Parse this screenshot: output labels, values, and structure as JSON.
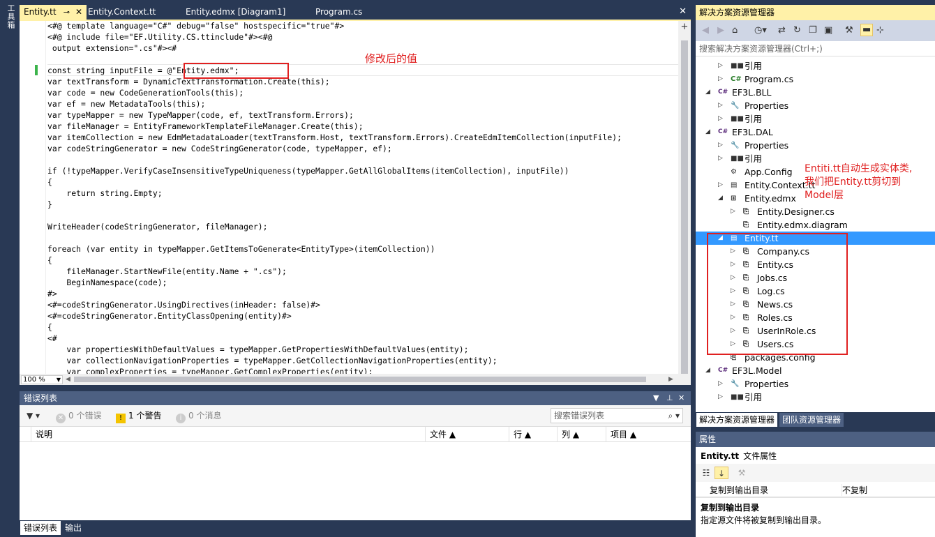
{
  "toolbox": {
    "label": "工具箱"
  },
  "editor_tabs": [
    {
      "label": "Entity.tt",
      "pin": "⊸",
      "close": "✕"
    },
    {
      "label": "Entity.Context.tt"
    },
    {
      "label": "Entity.edmx [Diagram1]"
    },
    {
      "label": "Program.cs"
    }
  ],
  "editor": {
    "lines": [
      "<#@ template language=\"C#\" debug=\"false\" hostspecific=\"true\"#>",
      "<#@ include file=\"EF.Utility.CS.ttinclude\"#><#@",
      " output extension=\".cs\"#><#",
      "",
      "const string inputFile = @\"Entity.edmx\";",
      "var textTransform = DynamicTextTransformation.Create(this);",
      "var code = new CodeGenerationTools(this);",
      "var ef = new MetadataTools(this);",
      "var typeMapper = new TypeMapper(code, ef, textTransform.Errors);",
      "var fileManager = EntityFrameworkTemplateFileManager.Create(this);",
      "var itemCollection = new EdmMetadataLoader(textTransform.Host, textTransform.Errors).CreateEdmItemCollection(inputFile);",
      "var codeStringGenerator = new CodeStringGenerator(code, typeMapper, ef);",
      "",
      "if (!typeMapper.VerifyCaseInsensitiveTypeUniqueness(typeMapper.GetAllGlobalItems(itemCollection), inputFile))",
      "{",
      "    return string.Empty;",
      "}",
      "",
      "WriteHeader(codeStringGenerator, fileManager);",
      "",
      "foreach (var entity in typeMapper.GetItemsToGenerate<EntityType>(itemCollection))",
      "{",
      "    fileManager.StartNewFile(entity.Name + \".cs\");",
      "    BeginNamespace(code);",
      "#>",
      "<#=codeStringGenerator.UsingDirectives(inHeader: false)#>",
      "<#=codeStringGenerator.EntityClassOpening(entity)#>",
      "{",
      "<#",
      "    var propertiesWithDefaultValues = typeMapper.GetPropertiesWithDefaultValues(entity);",
      "    var collectionNavigationProperties = typeMapper.GetCollectionNavigationProperties(entity);",
      "    var complexProperties = typeMapper.GetComplexProperties(entity);"
    ],
    "annotation": "修改后的值",
    "zoom": "100 %"
  },
  "error_list": {
    "title": "错误列表",
    "errors": "0 个错误",
    "warnings": "1 个警告",
    "messages": "0 个消息",
    "search_placeholder": "搜索错误列表",
    "columns": [
      "说明",
      "文件",
      "行",
      "列",
      "项目"
    ]
  },
  "bottom_tabs": [
    "错误列表",
    "输出"
  ],
  "solution_explorer": {
    "title": "解决方案资源管理器",
    "search_placeholder": "搜索解决方案资源管理器(Ctrl+;)",
    "annotation_lines": [
      "Entiti.tt自动生成实体类,",
      "我们把Entity.tt剪切到",
      "Model层"
    ],
    "tree": [
      {
        "label": "引用",
        "icon": "references-icon",
        "glyph": "■■",
        "arrow": "▷",
        "indent": 1
      },
      {
        "label": "Program.cs",
        "icon": "csharp-file-icon",
        "glyph": "C#",
        "arrow": "▷",
        "indent": 1
      },
      {
        "label": "EF3L.BLL",
        "icon": "project-icon",
        "glyph": "C#",
        "arrow": "◢",
        "indent": 0
      },
      {
        "label": "Properties",
        "icon": "wrench-icon",
        "glyph": "🔧",
        "arrow": "▷",
        "indent": 1
      },
      {
        "label": "引用",
        "icon": "references-icon",
        "glyph": "■■",
        "arrow": "▷",
        "indent": 1
      },
      {
        "label": "EF3L.DAL",
        "icon": "project-icon",
        "glyph": "C#",
        "arrow": "◢",
        "indent": 0
      },
      {
        "label": "Properties",
        "icon": "wrench-icon",
        "glyph": "🔧",
        "arrow": "▷",
        "indent": 1
      },
      {
        "label": "引用",
        "icon": "references-icon",
        "glyph": "■■",
        "arrow": "▷",
        "indent": 1
      },
      {
        "label": "App.Config",
        "icon": "config-file-icon",
        "glyph": "⚙",
        "arrow": "",
        "indent": 1
      },
      {
        "label": "Entity.Context.tt",
        "icon": "tt-file-icon",
        "glyph": "▤",
        "arrow": "▷",
        "indent": 1
      },
      {
        "label": "Entity.edmx",
        "icon": "edmx-file-icon",
        "glyph": "⊞",
        "arrow": "◢",
        "indent": 1
      },
      {
        "label": "Entity.Designer.cs",
        "icon": "cs-file-icon",
        "glyph": "⎘",
        "arrow": "▷",
        "indent": 2
      },
      {
        "label": "Entity.edmx.diagram",
        "icon": "diagram-file-icon",
        "glyph": "⎘",
        "arrow": "",
        "indent": 2
      },
      {
        "label": "Entity.tt",
        "icon": "tt-file-icon",
        "glyph": "▤",
        "arrow": "◢",
        "indent": 1,
        "selected": true
      },
      {
        "label": "Company.cs",
        "icon": "cs-file-icon",
        "glyph": "⎘",
        "arrow": "▷",
        "indent": 2
      },
      {
        "label": "Entity.cs",
        "icon": "cs-file-icon",
        "glyph": "⎘",
        "arrow": "▷",
        "indent": 2
      },
      {
        "label": "Jobs.cs",
        "icon": "cs-file-icon",
        "glyph": "⎘",
        "arrow": "▷",
        "indent": 2
      },
      {
        "label": "Log.cs",
        "icon": "cs-file-icon",
        "glyph": "⎘",
        "arrow": "▷",
        "indent": 2
      },
      {
        "label": "News.cs",
        "icon": "cs-file-icon",
        "glyph": "⎘",
        "arrow": "▷",
        "indent": 2
      },
      {
        "label": "Roles.cs",
        "icon": "cs-file-icon",
        "glyph": "⎘",
        "arrow": "▷",
        "indent": 2
      },
      {
        "label": "UserInRole.cs",
        "icon": "cs-file-icon",
        "glyph": "⎘",
        "arrow": "▷",
        "indent": 2
      },
      {
        "label": "Users.cs",
        "icon": "cs-file-icon",
        "glyph": "⎘",
        "arrow": "▷",
        "indent": 2
      },
      {
        "label": "packages.config",
        "icon": "config-file-icon",
        "glyph": "⎘",
        "arrow": "",
        "indent": 1
      },
      {
        "label": "EF3L.Model",
        "icon": "project-icon",
        "glyph": "C#",
        "arrow": "◢",
        "indent": 0
      },
      {
        "label": "Properties",
        "icon": "wrench-icon",
        "glyph": "🔧",
        "arrow": "▷",
        "indent": 1
      },
      {
        "label": "引用",
        "icon": "references-icon",
        "glyph": "■■",
        "arrow": "▷",
        "indent": 1
      }
    ]
  },
  "side_tabs": [
    "解决方案资源管理器",
    "团队资源管理器"
  ],
  "properties": {
    "title": "属性",
    "object_name": "Entity.tt",
    "object_type": "文件属性",
    "row_key": "复制到输出目录",
    "row_value": "不复制",
    "desc_title": "复制到输出目录",
    "desc_text": "指定源文件将被复制到输出目录。"
  },
  "colors": {
    "chrome": "#293955",
    "active_tab": "#fff1a8",
    "selection": "#3399ff",
    "annotation_red": "#e02020"
  }
}
